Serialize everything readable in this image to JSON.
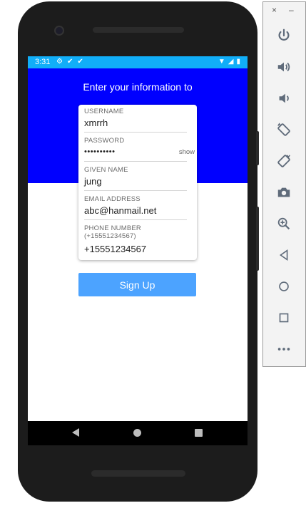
{
  "status_bar": {
    "time": "3:31",
    "left_icons": [
      "gear-icon",
      "check-icon",
      "check-icon"
    ],
    "right_icons": [
      "wifi-icon",
      "signal-icon",
      "battery-icon"
    ],
    "color": "#11aef8"
  },
  "form": {
    "heading": "Enter your information to",
    "band_color": "#0000ff",
    "fields": [
      {
        "label": "USERNAME",
        "value": "xmrrh"
      },
      {
        "label": "PASSWORD",
        "value": "••••••••••",
        "toggle": "show"
      },
      {
        "label": "GIVEN NAME",
        "value": "jung"
      },
      {
        "label": "EMAIL ADDRESS",
        "value": "abc@hanmail.net"
      },
      {
        "label": "PHONE NUMBER (+15551234567)",
        "value": "+15551234567"
      }
    ],
    "submit_label": "Sign Up",
    "submit_color": "#4ca3ff"
  },
  "nav_bar": {
    "buttons": [
      "back-icon",
      "home-icon",
      "recent-apps-icon"
    ]
  },
  "emulator_panel": {
    "window_controls": {
      "close": "×",
      "minimize": "–"
    },
    "controls": [
      "power-icon",
      "volume-up-icon",
      "volume-down-icon",
      "rotate-left-icon",
      "rotate-right-icon",
      "camera-icon",
      "zoom-icon",
      "back-icon",
      "home-icon",
      "overview-icon",
      "more-icon"
    ]
  }
}
